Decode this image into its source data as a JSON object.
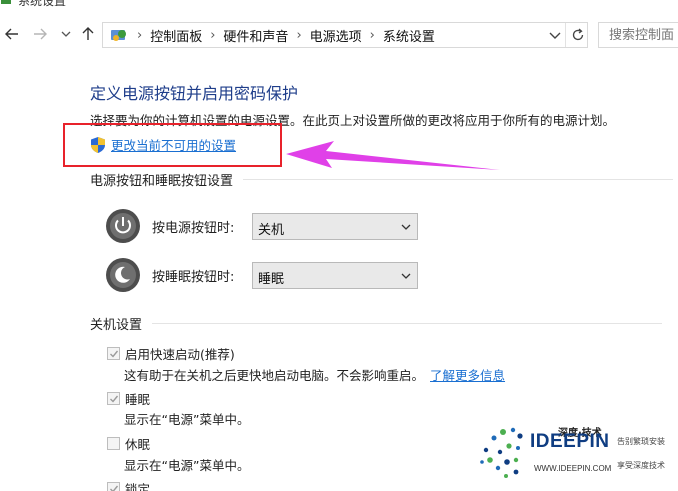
{
  "window": {
    "title": "系统设置",
    "icon": "power-options-icon"
  },
  "nav": {
    "back_icon": "back-arrow-icon",
    "forward_icon": "forward-arrow-icon",
    "recent_icon": "chevron-down-icon",
    "up_icon": "up-arrow-icon"
  },
  "address": {
    "breadcrumbs": [
      "控制面板",
      "硬件和声音",
      "电源选项",
      "系统设置"
    ],
    "separator": "›",
    "dropdown_icon": "chevron-down-icon",
    "refresh_icon": "refresh-icon"
  },
  "search": {
    "placeholder": "搜索控制面"
  },
  "page": {
    "heading": "定义电源按钮并启用密码保护",
    "description": "选择要为你的计算机设置的电源设置。在此页上对设置所做的更改将应用于你所有的电源计划。",
    "uac_link": "更改当前不可用的设置",
    "uac_icon": "uac-shield-icon"
  },
  "buttons_section": {
    "title": "电源按钮和睡眠按钮设置",
    "power_label": "按电源按钮时:",
    "power_value": "关机",
    "sleep_label": "按睡眠按钮时:",
    "sleep_value": "睡眠"
  },
  "shutdown_section": {
    "title": "关机设置",
    "items": [
      {
        "label": "启用快速启动(推荐)",
        "checked": true,
        "desc": "这有助于在关机之后更快地启动电脑。不会影响重启。",
        "link": "了解更多信息"
      },
      {
        "label": "睡眠",
        "checked": true,
        "desc": "显示在“电源”菜单中。"
      },
      {
        "label": "休眠",
        "checked": false,
        "desc": "显示在“电源”菜单中。"
      },
      {
        "label": "锁定",
        "checked": true
      }
    ]
  },
  "watermark": {
    "top": "深度·技术",
    "brand": "IDEEPIN",
    "url": "WWW.IDEEPIN.COM",
    "tag1": "告别繁琐安装",
    "tag2": "享受深度技术"
  },
  "colors": {
    "heading": "#1e3d8a",
    "link": "#1a6fd1",
    "highlight_box": "#e8222b",
    "arrow": "#e040e8"
  }
}
